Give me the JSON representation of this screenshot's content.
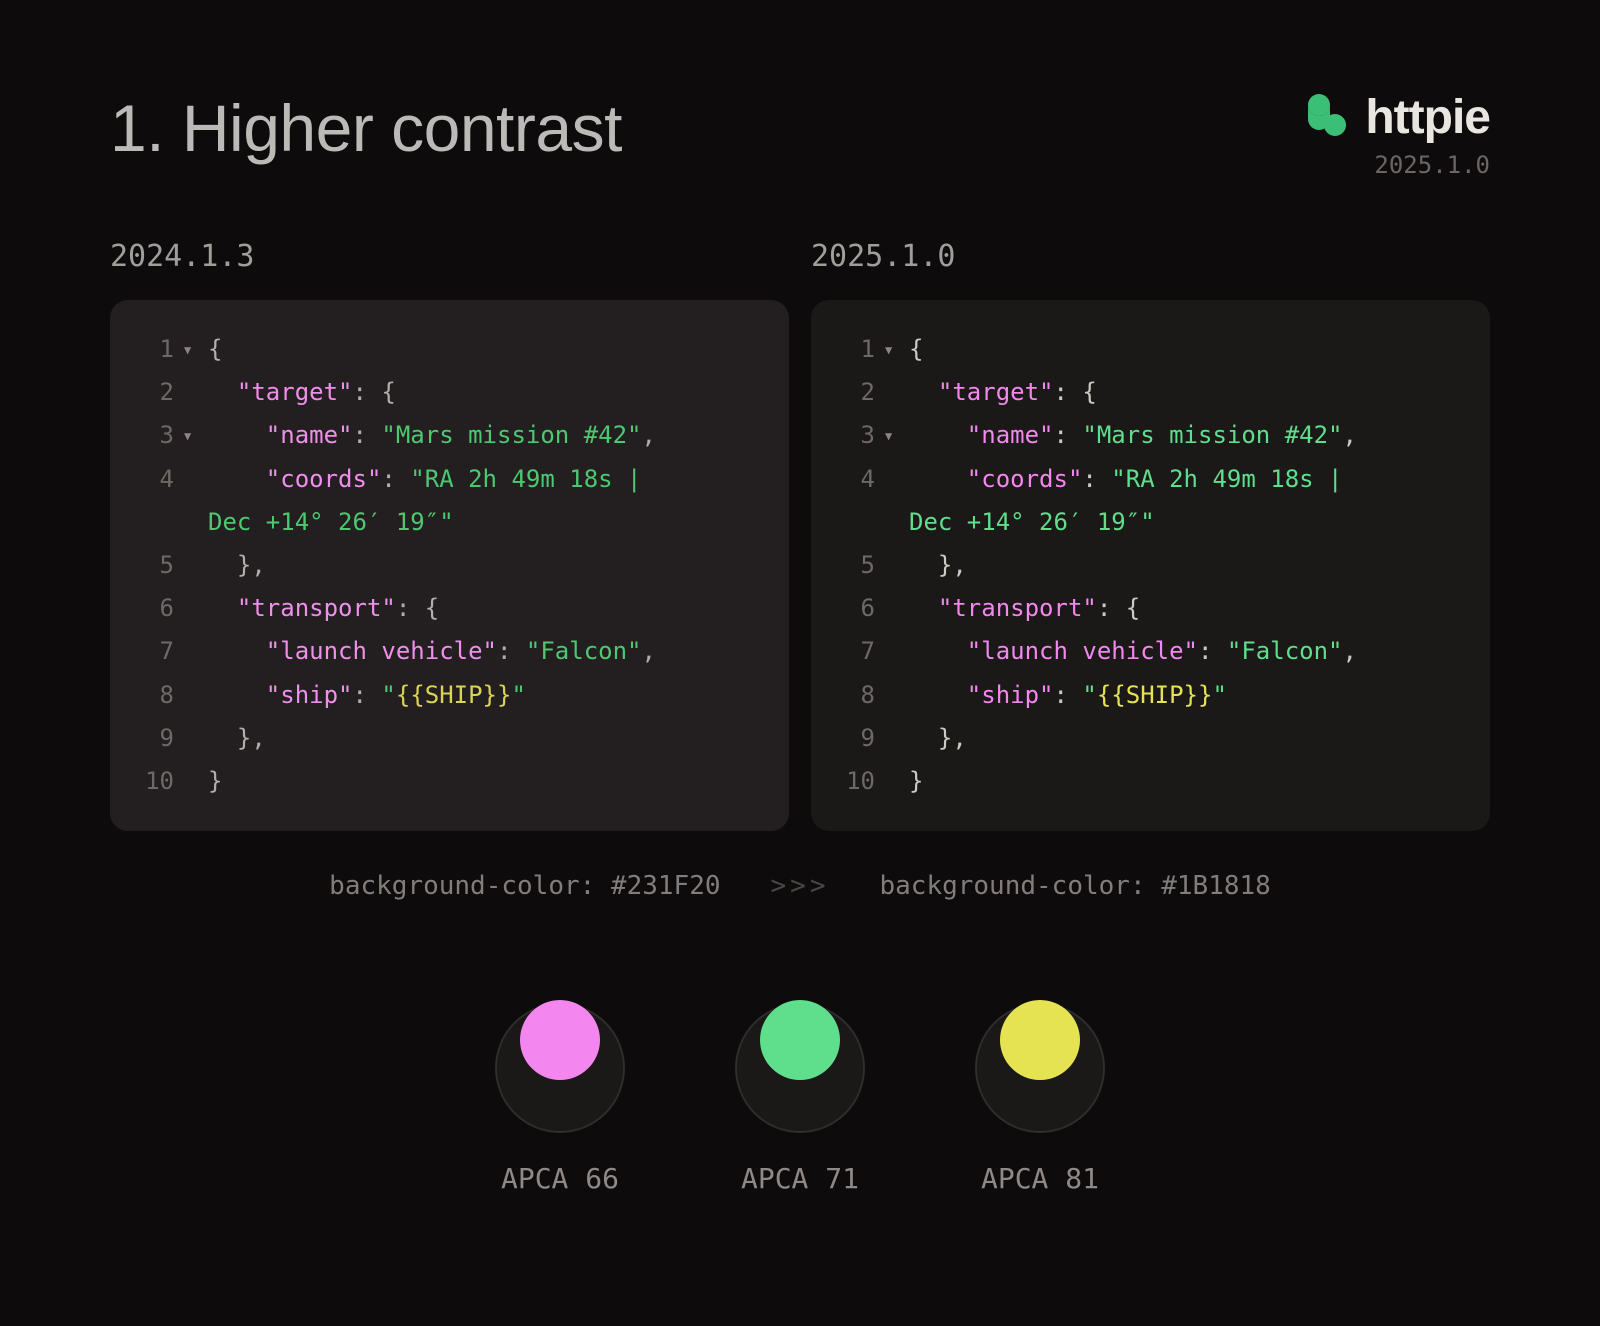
{
  "title": "1. Higher contrast",
  "brand": {
    "name": "httpie",
    "version": "2025.1.0"
  },
  "left": {
    "version": "2024.1.3",
    "bg": "#231F20",
    "caption": "background-color: #231F20",
    "lines": [
      {
        "n": "1",
        "fold": true,
        "tokens": [
          [
            "punc",
            "{"
          ]
        ]
      },
      {
        "n": "2",
        "fold": false,
        "tokens": [
          [
            "sp",
            "  "
          ],
          [
            "key",
            "\"target\""
          ],
          [
            "punc",
            ": {"
          ]
        ]
      },
      {
        "n": "3",
        "fold": true,
        "tokens": [
          [
            "sp",
            "    "
          ],
          [
            "key",
            "\"name\""
          ],
          [
            "punc",
            ": "
          ],
          [
            "str",
            "\"Mars mission #42\""
          ],
          [
            "punc",
            ","
          ]
        ]
      },
      {
        "n": "4",
        "fold": false,
        "tokens": [
          [
            "sp",
            "    "
          ],
          [
            "key",
            "\"coords\""
          ],
          [
            "punc",
            ": "
          ],
          [
            "str",
            "\"RA 2h 49m 18s | "
          ]
        ]
      },
      {
        "n": "",
        "fold": false,
        "wrap": true,
        "tokens": [
          [
            "str",
            "Dec +14° 26′ 19″\""
          ]
        ]
      },
      {
        "n": "5",
        "fold": false,
        "tokens": [
          [
            "sp",
            "  "
          ],
          [
            "punc",
            "},"
          ]
        ]
      },
      {
        "n": "6",
        "fold": false,
        "tokens": [
          [
            "sp",
            "  "
          ],
          [
            "key",
            "\"transport\""
          ],
          [
            "punc",
            ": {"
          ]
        ]
      },
      {
        "n": "7",
        "fold": false,
        "tokens": [
          [
            "sp",
            "    "
          ],
          [
            "key",
            "\"launch vehicle\""
          ],
          [
            "punc",
            ": "
          ],
          [
            "str",
            "\"Falcon\""
          ],
          [
            "punc",
            ","
          ]
        ]
      },
      {
        "n": "8",
        "fold": false,
        "tokens": [
          [
            "sp",
            "    "
          ],
          [
            "key",
            "\"ship\""
          ],
          [
            "punc",
            ": "
          ],
          [
            "str",
            "\""
          ],
          [
            "var",
            "{{SHIP}}"
          ],
          [
            "str",
            "\""
          ]
        ]
      },
      {
        "n": "9",
        "fold": false,
        "tokens": [
          [
            "sp",
            "  "
          ],
          [
            "punc",
            "},"
          ]
        ]
      },
      {
        "n": "10",
        "fold": false,
        "tokens": [
          [
            "punc",
            "}"
          ]
        ]
      }
    ]
  },
  "right": {
    "version": "2025.1.0",
    "bg": "#1B1818",
    "caption": "background-color: #1B1818",
    "lines": [
      {
        "n": "1",
        "fold": true,
        "tokens": [
          [
            "punc",
            "{"
          ]
        ]
      },
      {
        "n": "2",
        "fold": false,
        "tokens": [
          [
            "sp",
            "  "
          ],
          [
            "key",
            "\"target\""
          ],
          [
            "punc",
            ": {"
          ]
        ]
      },
      {
        "n": "3",
        "fold": true,
        "tokens": [
          [
            "sp",
            "    "
          ],
          [
            "key",
            "\"name\""
          ],
          [
            "punc",
            ": "
          ],
          [
            "str",
            "\"Mars mission #42\""
          ],
          [
            "punc",
            ","
          ]
        ]
      },
      {
        "n": "4",
        "fold": false,
        "tokens": [
          [
            "sp",
            "    "
          ],
          [
            "key",
            "\"coords\""
          ],
          [
            "punc",
            ": "
          ],
          [
            "str",
            "\"RA 2h 49m 18s | "
          ]
        ]
      },
      {
        "n": "",
        "fold": false,
        "wrap": true,
        "tokens": [
          [
            "str",
            "Dec +14° 26′ 19″\""
          ]
        ]
      },
      {
        "n": "5",
        "fold": false,
        "tokens": [
          [
            "sp",
            "  "
          ],
          [
            "punc",
            "},"
          ]
        ]
      },
      {
        "n": "6",
        "fold": false,
        "tokens": [
          [
            "sp",
            "  "
          ],
          [
            "key",
            "\"transport\""
          ],
          [
            "punc",
            ": {"
          ]
        ]
      },
      {
        "n": "7",
        "fold": false,
        "tokens": [
          [
            "sp",
            "    "
          ],
          [
            "key",
            "\"launch vehicle\""
          ],
          [
            "punc",
            ": "
          ],
          [
            "str",
            "\"Falcon\""
          ],
          [
            "punc",
            ","
          ]
        ]
      },
      {
        "n": "8",
        "fold": false,
        "tokens": [
          [
            "sp",
            "    "
          ],
          [
            "key",
            "\"ship\""
          ],
          [
            "punc",
            ": "
          ],
          [
            "str",
            "\""
          ],
          [
            "var",
            "{{SHIP}}"
          ],
          [
            "str",
            "\""
          ]
        ]
      },
      {
        "n": "9",
        "fold": false,
        "tokens": [
          [
            "sp",
            "  "
          ],
          [
            "punc",
            "},"
          ]
        ]
      },
      {
        "n": "10",
        "fold": false,
        "tokens": [
          [
            "punc",
            "}"
          ]
        ]
      }
    ]
  },
  "separator": ">>>",
  "swatches": [
    {
      "label": "APCA 66",
      "color": "#f386ef"
    },
    {
      "label": "APCA 71",
      "color": "#5fde8b"
    },
    {
      "label": "APCA 81",
      "color": "#e6e353"
    }
  ]
}
